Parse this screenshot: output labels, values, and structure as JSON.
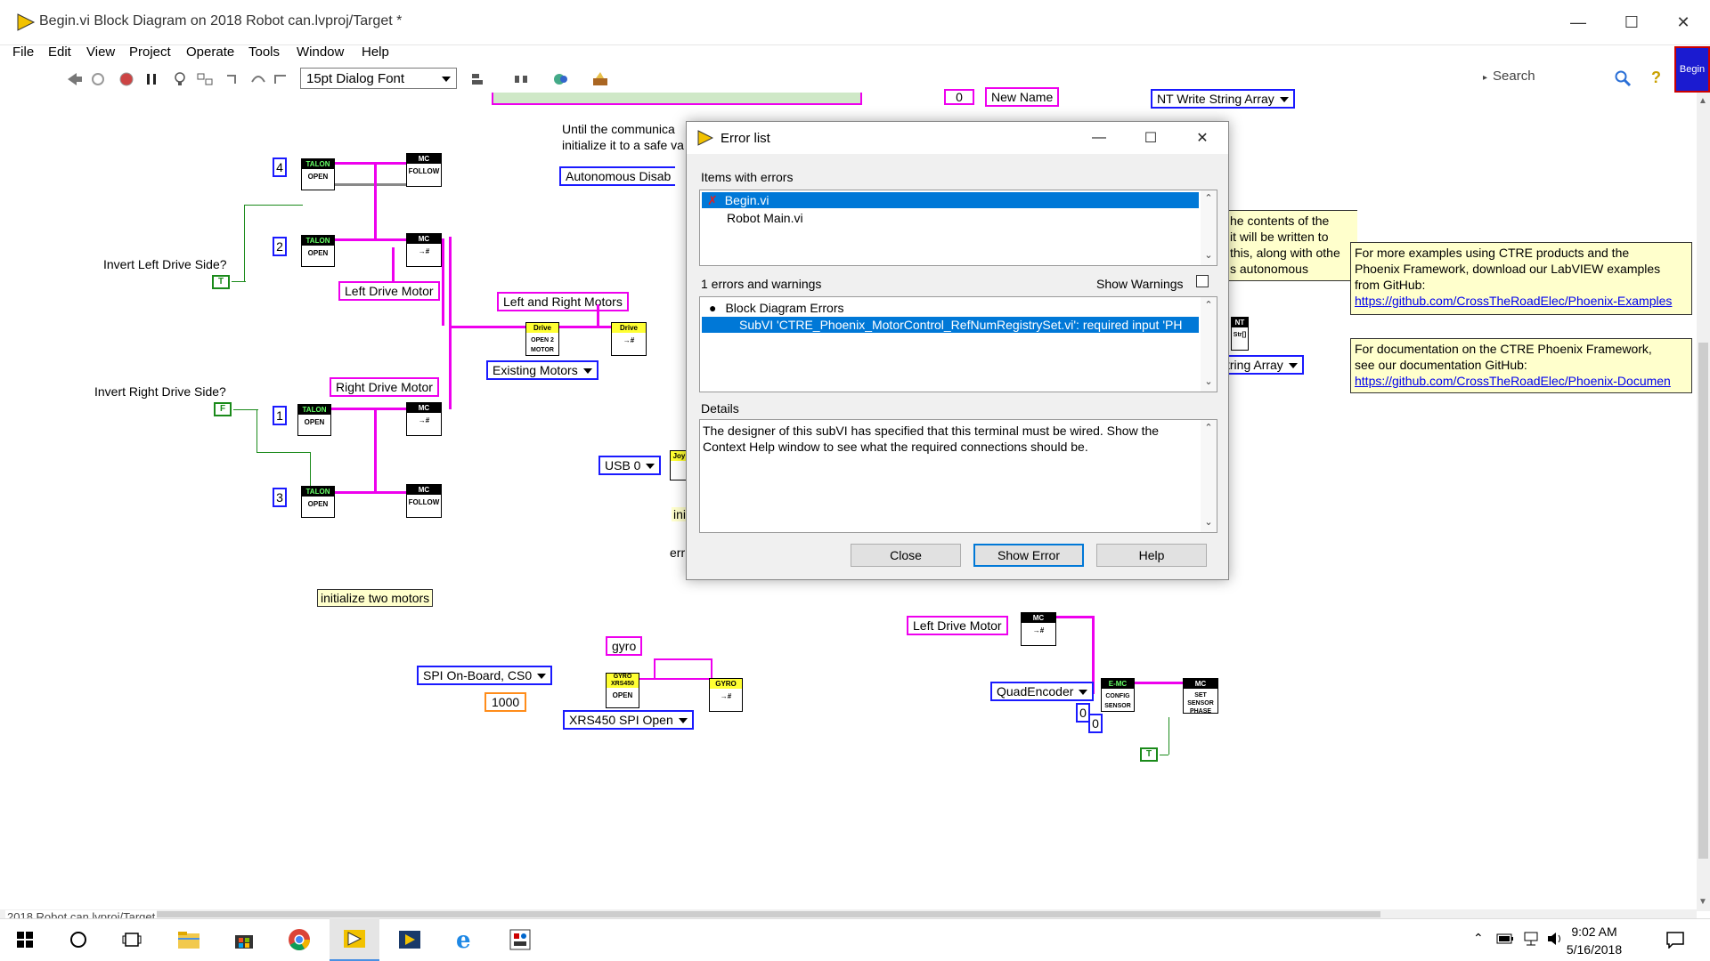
{
  "window": {
    "title": "Begin.vi Block Diagram on 2018 Robot can.lvproj/Target *",
    "minimize": "—",
    "maximize": "☐",
    "close": "✕"
  },
  "menu": [
    "File",
    "Edit",
    "View",
    "Project",
    "Operate",
    "Tools",
    "Window",
    "Help"
  ],
  "toolbar": {
    "font": "15pt Dialog Font",
    "search_placeholder": "Search",
    "help_glyph": "?",
    "begin_tile": "Begin"
  },
  "diagram": {
    "top_label_partial": "Until the communica",
    "top_label_partial2": "initialize it to a safe va",
    "autonomous_box": "Autonomous Disab",
    "new_name": "New Name",
    "nt_write": "NT Write String Array",
    "tring_array": "tring Array",
    "invert_left": "Invert Left Drive Side?",
    "invert_right": "Invert Right Drive Side?",
    "left_drive_motor": "Left Drive Motor",
    "right_drive_motor": "Right Drive Motor",
    "left_and_right": "Left and Right Motors",
    "existing_motors": "Existing Motors",
    "usb0": "USB 0",
    "init_two": "initialize two motors",
    "gyro": "gyro",
    "spi_onboard": "SPI On-Board, CS0",
    "num_1000": "1000",
    "xrs450": "XRS450 SPI Open",
    "left_drive_motor2": "Left Drive Motor",
    "quadencoder": "QuadEncoder",
    "zero": "0",
    "zero2": "0",
    "num4": "4",
    "num2": "2",
    "num1": "1",
    "num3": "3",
    "bool_t": "T",
    "bool_f": "F",
    "bool_t2": "T",
    "ini_partial": "ini",
    "err_partial": "err",
    "note_contents": [
      "he contents of the",
      " it will be written to",
      "this, along with othe",
      "s autonomous"
    ],
    "note_examples": {
      "line1": "For more examples using CTRE products and the",
      "line2": "Phoenix Framework, download our LabVIEW examples",
      "line3": "from GitHub:",
      "link": "https://github.com/CrossTheRoadElec/Phoenix-Examples"
    },
    "note_docs": {
      "line1": "For documentation on the CTRE Phoenix Framework,",
      "line2": "see our documentation GitHub:",
      "link": "https://github.com/CrossTheRoadElec/Phoenix-Documen"
    },
    "vi_labels": {
      "talon": "TALON",
      "open": "OPEN",
      "mc": "MC",
      "follow": "FOLLOW",
      "drive": "Drive",
      "open2motor": "OPEN 2 MOTOR",
      "gyro_xrs": "GYRO XRS450",
      "gyro": "GYRO",
      "emc": "E-MC",
      "config_sensor": "CONFIG SENSOR",
      "set_sensor_phase": "SET SENSOR PHASE",
      "nt": "NT",
      "str": "Str[]",
      "joy": "Joy",
      "setter": "→#"
    }
  },
  "dialog": {
    "title": "Error list",
    "items_label": "Items with errors",
    "items": [
      {
        "name": "Begin.vi",
        "selected": true,
        "error": true
      },
      {
        "name": "Robot Main.vi",
        "selected": false,
        "error": false
      }
    ],
    "count_label": "1 errors and warnings",
    "show_warnings": "Show Warnings",
    "errors": [
      {
        "text": "Block Diagram Errors",
        "selected": false
      },
      {
        "text": "SubVI 'CTRE_Phoenix_MotorControl_RefNumRegistrySet.vi': required input 'PH",
        "selected": true
      }
    ],
    "details_label": "Details",
    "details": "The designer of this subVI has specified that this terminal must be wired.  Show the Context Help window to see what the required connections should be.",
    "buttons": {
      "close": "Close",
      "show_error": "Show Error",
      "help": "Help"
    }
  },
  "statusbar": {
    "project": "2018 Robot can.lvproj/Target"
  },
  "taskbar": {
    "time": "9:02 AM",
    "date": "5/16/2018"
  }
}
